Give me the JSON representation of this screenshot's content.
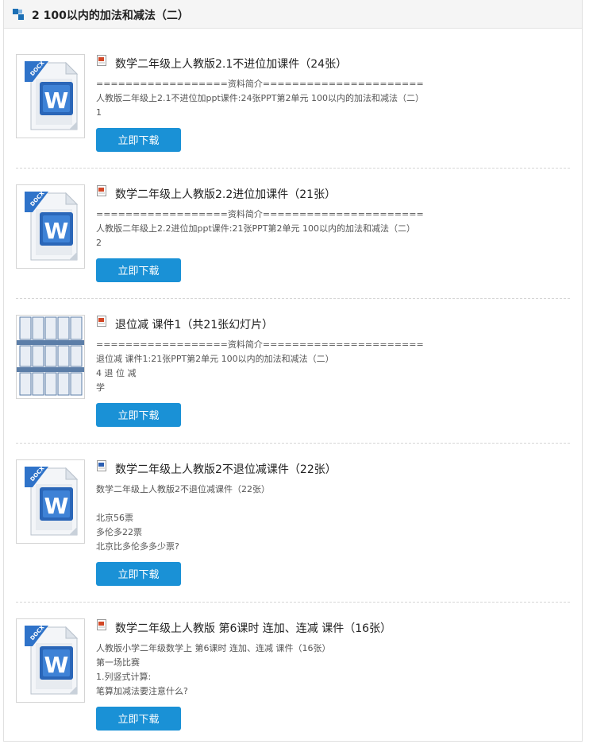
{
  "section": {
    "title": "2 100以内的加法和减法（二）"
  },
  "items": [
    {
      "title": "数学二年级上人教版2.1不进位加课件（24张）",
      "lines": [
        "==================资料简介======================",
        "人教版二年级上2.1不进位加ppt课件:24张PPT第2单元 100以内的加法和减法（二）",
        "1"
      ],
      "button": "立即下载",
      "thumb": "docx-icon",
      "title_icon": "ppt-file-icon"
    },
    {
      "title": "数学二年级上人教版2.2进位加课件（21张）",
      "lines": [
        "==================资料简介======================",
        "人教版二年级上2.2进位加ppt课件:21张PPT第2单元 100以内的加法和减法（二）",
        "2"
      ],
      "button": "立即下载",
      "thumb": "docx-icon",
      "title_icon": "ppt-file-icon"
    },
    {
      "title": "退位减 课件1（共21张幻灯片）",
      "lines": [
        "==================资料简介======================",
        "退位减 课件1:21张PPT第2单元 100以内的加法和减法（二）",
        "4 退 位 减",
        "学"
      ],
      "button": "立即下载",
      "thumb": "slide-grid-thumbnail",
      "title_icon": "ppt-file-icon"
    },
    {
      "title": "数学二年级上人教版2不退位减课件（22张）",
      "lines": [
        "数学二年级上人教版2不退位减课件（22张）",
        "",
        "北京56票",
        "多伦多22票",
        "北京比多伦多多少票?"
      ],
      "button": "立即下载",
      "thumb": "docx-icon",
      "title_icon": "doc-file-icon"
    },
    {
      "title": "数学二年级上人教版 第6课时 连加、连减 课件（16张）",
      "lines": [
        "人教版小学二年级数学上 第6课时 连加、连减 课件（16张）",
        "第一场比赛",
        "1.列竖式计算:",
        "笔算加减法要注意什么?"
      ],
      "button": "立即下载",
      "thumb": "docx-icon",
      "title_icon": "ppt-file-icon"
    }
  ]
}
